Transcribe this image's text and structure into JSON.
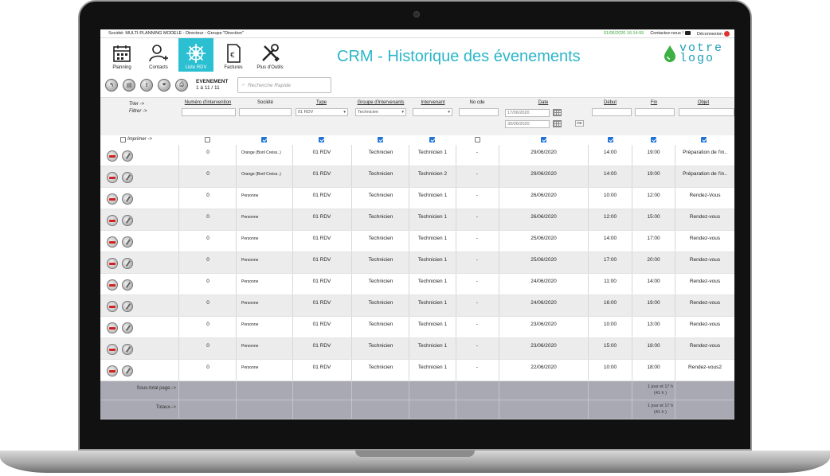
{
  "topbar": {
    "company": "Société: MULTI-PLANNING MODELE -   Directeur - Groupe \"Direction\"",
    "datetime": "01/06/2020 16:14:55",
    "contact": "Contactez-nous !",
    "logout": "Déconnexion"
  },
  "nav": [
    {
      "label": "Planning",
      "icon": "calendar-icon"
    },
    {
      "label": "Contacts",
      "icon": "add-contact-icon"
    },
    {
      "label": "Liste RDV",
      "icon": "ship-wheel-icon"
    },
    {
      "label": "Factures",
      "icon": "invoice-icon"
    },
    {
      "label": "Plus d'Outils",
      "icon": "tools-icon"
    }
  ],
  "page_title": "CRM - Historique des évenements",
  "logo": {
    "line1": "votre",
    "line2": "logo"
  },
  "toolbar": {
    "event_title": "EVENEMENT",
    "event_range": "1 à 11 / 11",
    "search_placeholder": "Recherche Rapide"
  },
  "filters": {
    "trier": "Trier ->",
    "filtrer": "Filtrer ->",
    "type_value": "01 RDV",
    "groupe_value": "Technicien",
    "date_from": "17/06/2020",
    "date_to": "30/06/2020",
    "ok": "OK",
    "print": "Imprimer ->"
  },
  "columns": [
    "Numéro d'intervention",
    "Société",
    "Type",
    "Groupe d'intervenants",
    "Intervenant",
    "No cde",
    "Date",
    "Début",
    "Fin",
    "Objet"
  ],
  "rows": [
    {
      "num": "0",
      "societe": "Orange (Boril Creiss..)",
      "type": "01 RDV",
      "groupe": "Technicien",
      "intervenant": "Technicien 1",
      "nocde": "-",
      "date": "29/06/2020",
      "debut": "14:00",
      "fin": "19:00",
      "objet": "Préparation de l'in.."
    },
    {
      "num": "0",
      "societe": "Orange (Boril Creiss..)",
      "type": "01 RDV",
      "groupe": "Technicien",
      "intervenant": "Technicien 2",
      "nocde": "-",
      "date": "29/06/2020",
      "debut": "14:00",
      "fin": "19:00",
      "objet": "Préparation de l'in.."
    },
    {
      "num": "0",
      "societe": "Personne",
      "type": "01 RDV",
      "groupe": "Technicien",
      "intervenant": "Technicien 1",
      "nocde": "-",
      "date": "26/06/2020",
      "debut": "10:00",
      "fin": "12:00",
      "objet": "Rendez-Vous"
    },
    {
      "num": "0",
      "societe": "Personne",
      "type": "01 RDV",
      "groupe": "Technicien",
      "intervenant": "Technicien 1",
      "nocde": "-",
      "date": "26/06/2020",
      "debut": "12:00",
      "fin": "15:00",
      "objet": "Rendez-vous"
    },
    {
      "num": "0",
      "societe": "Personne",
      "type": "01 RDV",
      "groupe": "Technicien",
      "intervenant": "Technicien 1",
      "nocde": "-",
      "date": "25/06/2020",
      "debut": "14:00",
      "fin": "17:00",
      "objet": "Rendez-vous"
    },
    {
      "num": "0",
      "societe": "Personne",
      "type": "01 RDV",
      "groupe": "Technicien",
      "intervenant": "Technicien 1",
      "nocde": "-",
      "date": "25/06/2020",
      "debut": "17:00",
      "fin": "20:00",
      "objet": "Rendez-vous"
    },
    {
      "num": "0",
      "societe": "Personne",
      "type": "01 RDV",
      "groupe": "Technicien",
      "intervenant": "Technicien 1",
      "nocde": "-",
      "date": "24/06/2020",
      "debut": "11:00",
      "fin": "14:00",
      "objet": "Rendez-vous"
    },
    {
      "num": "0",
      "societe": "Personne",
      "type": "01 RDV",
      "groupe": "Technicien",
      "intervenant": "Technicien 1",
      "nocde": "-",
      "date": "24/06/2020",
      "debut": "16:00",
      "fin": "19:00",
      "objet": "Rendez-vous"
    },
    {
      "num": "0",
      "societe": "Personne",
      "type": "01 RDV",
      "groupe": "Technicien",
      "intervenant": "Technicien 1",
      "nocde": "-",
      "date": "23/06/2020",
      "debut": "10:00",
      "fin": "13:00",
      "objet": "Rendez-vous"
    },
    {
      "num": "0",
      "societe": "Personne",
      "type": "01 RDV",
      "groupe": "Technicien",
      "intervenant": "Technicien 1",
      "nocde": "-",
      "date": "23/06/2020",
      "debut": "15:00",
      "fin": "18:00",
      "objet": "Rendez-vous"
    },
    {
      "num": "0",
      "societe": "Personne",
      "type": "01 RDV",
      "groupe": "Technicien",
      "intervenant": "Technicien 1",
      "nocde": "-",
      "date": "22/06/2020",
      "debut": "10:00",
      "fin": "18:00",
      "objet": "Rendez-vous2"
    }
  ],
  "totals": {
    "subtotal_label": "Sous-total page-->",
    "total_label": "Totaux-->",
    "subtotal_value_1": "1 jour et 17 h",
    "subtotal_value_2": "(41 h )",
    "total_value_1": "1 jour et 17 h",
    "total_value_2": "(41 h )"
  },
  "colors": {
    "accent": "#2bbfd2",
    "title": "#2bb6c9",
    "logo": "#1c9fb6",
    "logo_drop": "#3cb043",
    "checkbox": "#1f73d6",
    "delete": "#d31f1f"
  }
}
